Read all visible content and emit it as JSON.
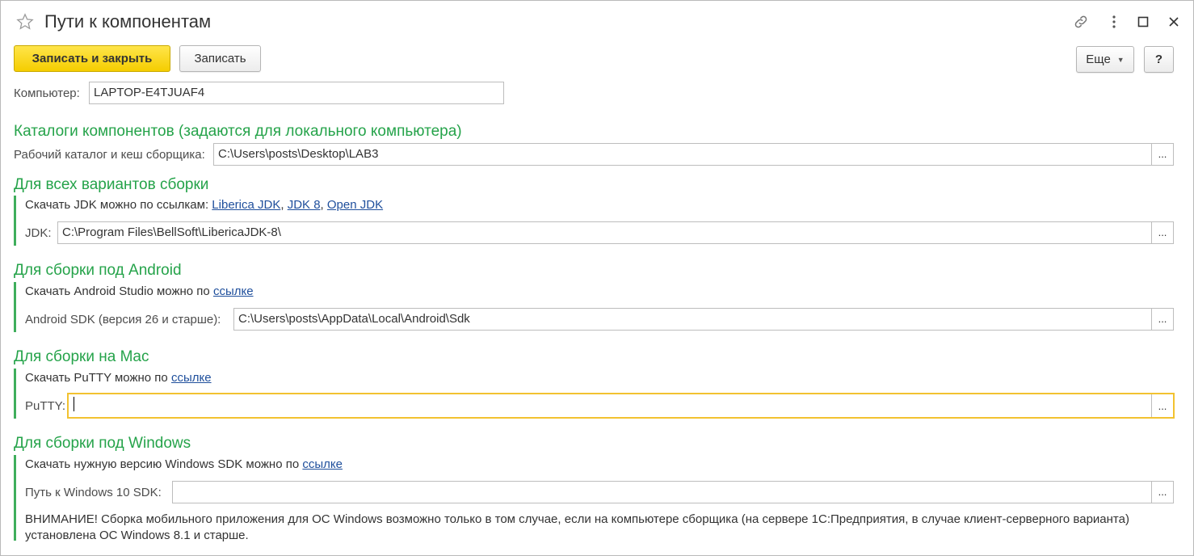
{
  "window": {
    "title": "Пути к компонентам"
  },
  "toolbar": {
    "save_close_label": "Записать и закрыть",
    "save_label": "Записать",
    "more_label": "Еще",
    "help_label": "?"
  },
  "computer": {
    "label": "Компьютер:",
    "value": "LAPTOP-E4TJUAF4"
  },
  "catalogs": {
    "heading": "Каталоги компонентов (задаются для локального компьютера)",
    "workdir_label": "Рабочий каталог и кеш сборщика:",
    "workdir_value": "C:\\Users\\posts\\Desktop\\LAB3"
  },
  "all_variants": {
    "heading": "Для всех вариантов сборки",
    "download_text": "Скачать JDK можно по ссылкам:",
    "links": [
      "Liberica JDK",
      "JDK 8",
      "Open JDK"
    ],
    "jdk_label": "JDK:",
    "jdk_value": "C:\\Program Files\\BellSoft\\LibericaJDK-8\\"
  },
  "android": {
    "heading": "Для сборки под Android",
    "download_text": "Скачать Android Studio можно по",
    "link": "ссылке",
    "sdk_label": "Android SDK (версия 26 и старше):",
    "sdk_value": "C:\\Users\\posts\\AppData\\Local\\Android\\Sdk"
  },
  "mac": {
    "heading": "Для сборки на Mac",
    "download_text": "Скачать PuTTY можно по",
    "link": "ссылке",
    "putty_label": "PuTTY:",
    "putty_value": ""
  },
  "windows": {
    "heading": "Для сборки под Windows",
    "download_text": "Скачать нужную версию Windows SDK можно по",
    "link": "ссылке",
    "sdk_label": "Путь к Windows 10 SDK:",
    "sdk_value": "",
    "warning": "ВНИМАНИЕ! Сборка мобильного приложения для ОС Windows возможно только в том случае, если на компьютере сборщика (на сервере 1С:Предприятия, в случае клиент-серверного варианта) установлена ОС Windows 8.1 и старше."
  },
  "select_button_label": "...",
  "icons": [
    "star-icon",
    "link-icon",
    "more-vertical-icon",
    "maximize-icon",
    "close-icon"
  ],
  "colors": {
    "accent_green": "#25a34a",
    "primary_button": "#f5cd00",
    "link": "#1f4f9c",
    "focus_border": "#f2c230"
  }
}
